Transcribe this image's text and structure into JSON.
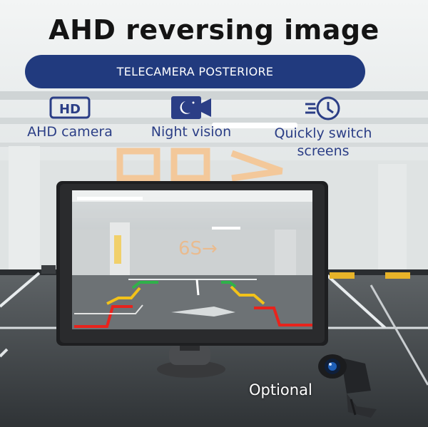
{
  "headline": "AHD reversing image",
  "banner": "TELECAMERA POSTERIORE",
  "features": [
    {
      "icon": "hd-icon",
      "label": "AHD camera"
    },
    {
      "icon": "night-vision-camera-icon",
      "label": "Night vision"
    },
    {
      "icon": "fast-clock-icon",
      "label": "Quickly switch screens"
    }
  ],
  "screen_sign": "6S→",
  "optional_label": "Optional",
  "colors": {
    "brand_blue": "#213a7e",
    "icon_blue": "#2b3e86",
    "guide_red": "#e8231c",
    "guide_yellow": "#f2c21a",
    "guide_green": "#2fb24a"
  }
}
